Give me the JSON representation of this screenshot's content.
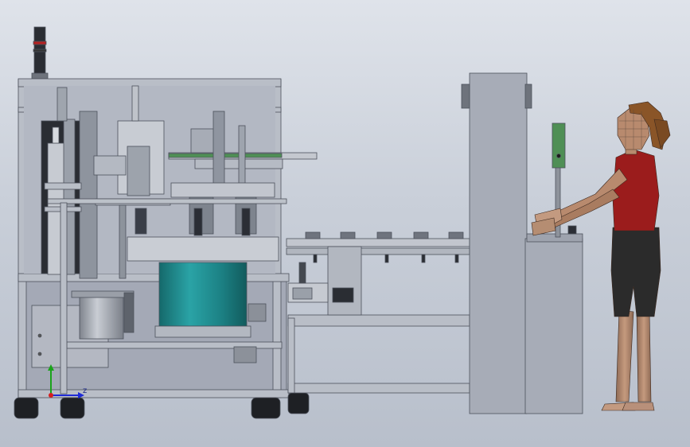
{
  "viewport": {
    "background_top": "#dfe3ea",
    "background_bottom": "#b8bfcb"
  },
  "triad": {
    "icon": "coordinate-triad-icon",
    "x_axis_color": "#1f2bd6",
    "y_axis_color": "#1aa31a",
    "z_axis_color": "#d61f1f",
    "axis_letter": "z"
  },
  "model": {
    "machine": "automated-assembly-machine",
    "conveyor": "conveyor-line",
    "console": "operator-console",
    "figure": "human-operator-figure",
    "colors": {
      "frame": "#b9bec7",
      "frame_edge": "#5b606a",
      "panel": "#a6abb8",
      "bowl": "#1f8c8f",
      "guard_rail": "#4f8f55",
      "shirt": "#9b1c1c",
      "shorts": "#2b2b2b",
      "skin": "#b88a6e",
      "hair": "#8a5528"
    }
  }
}
